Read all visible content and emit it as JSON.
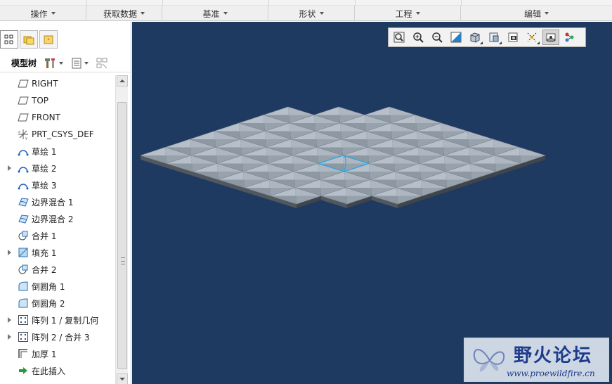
{
  "ribbon": {
    "groups": [
      {
        "label": "操作"
      },
      {
        "label": "获取数据"
      },
      {
        "label": "基准"
      },
      {
        "label": "形状"
      },
      {
        "label": "工程"
      },
      {
        "label": "编辑"
      }
    ]
  },
  "model_tree": {
    "title": "模型树",
    "items": [
      {
        "label": "RIGHT",
        "icon": "datum-plane-icon",
        "expandable": false
      },
      {
        "label": "TOP",
        "icon": "datum-plane-icon",
        "expandable": false
      },
      {
        "label": "FRONT",
        "icon": "datum-plane-icon",
        "expandable": false
      },
      {
        "label": "PRT_CSYS_DEF",
        "icon": "csys-icon",
        "expandable": false
      },
      {
        "label": "草绘 1",
        "icon": "sketch-icon",
        "expandable": false
      },
      {
        "label": "草绘 2",
        "icon": "sketch-icon",
        "expandable": true
      },
      {
        "label": "草绘 3",
        "icon": "sketch-icon",
        "expandable": false
      },
      {
        "label": "边界混合 1",
        "icon": "boundary-blend-icon",
        "expandable": false
      },
      {
        "label": "边界混合 2",
        "icon": "boundary-blend-icon",
        "expandable": false
      },
      {
        "label": "合并 1",
        "icon": "merge-icon",
        "expandable": false
      },
      {
        "label": "填充 1",
        "icon": "fill-icon",
        "expandable": true
      },
      {
        "label": "合并 2",
        "icon": "merge-icon",
        "expandable": false
      },
      {
        "label": "倒圆角 1",
        "icon": "round-icon",
        "expandable": false
      },
      {
        "label": "倒圆角 2",
        "icon": "round-icon",
        "expandable": false
      },
      {
        "label": "阵列 1 / 复制几何",
        "icon": "pattern-icon",
        "expandable": true
      },
      {
        "label": "阵列 2 / 合并 3",
        "icon": "pattern-icon",
        "expandable": true
      },
      {
        "label": "加厚 1",
        "icon": "thicken-icon",
        "expandable": false
      },
      {
        "label": "在此插入",
        "icon": "insert-here-icon",
        "expandable": false
      }
    ]
  },
  "view_toolbar": {
    "buttons": [
      "refit-icon",
      "zoom-in-icon",
      "zoom-out-icon",
      "repaint-icon",
      "display-style-icon",
      "saved-views-icon",
      "view-manager-icon",
      "datum-display-icon",
      "spin-center-icon",
      "annotation-display-icon"
    ]
  },
  "watermark": {
    "title": "野火论坛",
    "url": "www.proewildfire.cn"
  },
  "colors": {
    "viewport_bg": "#1f3a60",
    "model_face": "#a7b0bb",
    "model_edge": "#4a5057",
    "selection": "#27a8e0"
  }
}
